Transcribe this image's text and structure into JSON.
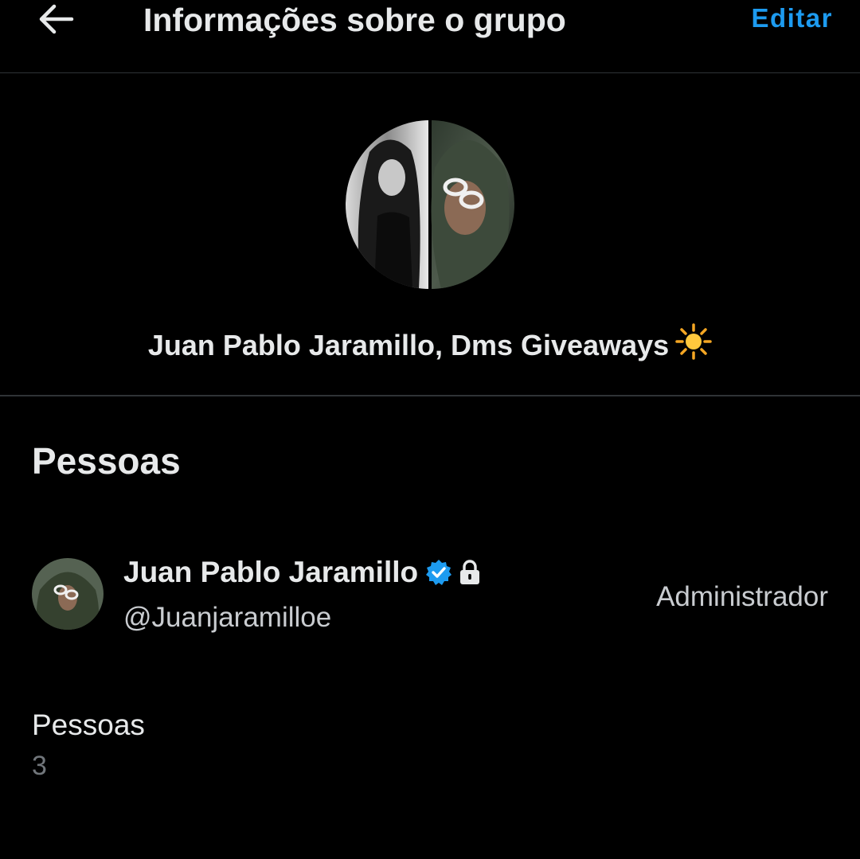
{
  "header": {
    "back_icon": "arrow-left-icon",
    "title": "Informações sobre o grupo",
    "edit_label": "Editar"
  },
  "group": {
    "avatar_icon": "group-avatar-photo",
    "name": "Juan Pablo Jaramillo, Dms Giveaways",
    "name_emoji_icon": "sun-emoji-icon"
  },
  "people_section": {
    "heading": "Pessoas",
    "members": [
      {
        "name": "Juan Pablo Jaramillo",
        "handle": "@Juanjaramilloe",
        "role": "Administrador",
        "verified_icon": "verified-badge-icon",
        "protected_icon": "lock-icon"
      }
    ]
  },
  "people_count": {
    "label": "Pessoas",
    "value": "3"
  },
  "colors": {
    "background": "#000000",
    "accent": "#1d9bf0",
    "primary_text": "#e7e9ea",
    "secondary_text": "#71767b",
    "divider": "#2f3336"
  }
}
